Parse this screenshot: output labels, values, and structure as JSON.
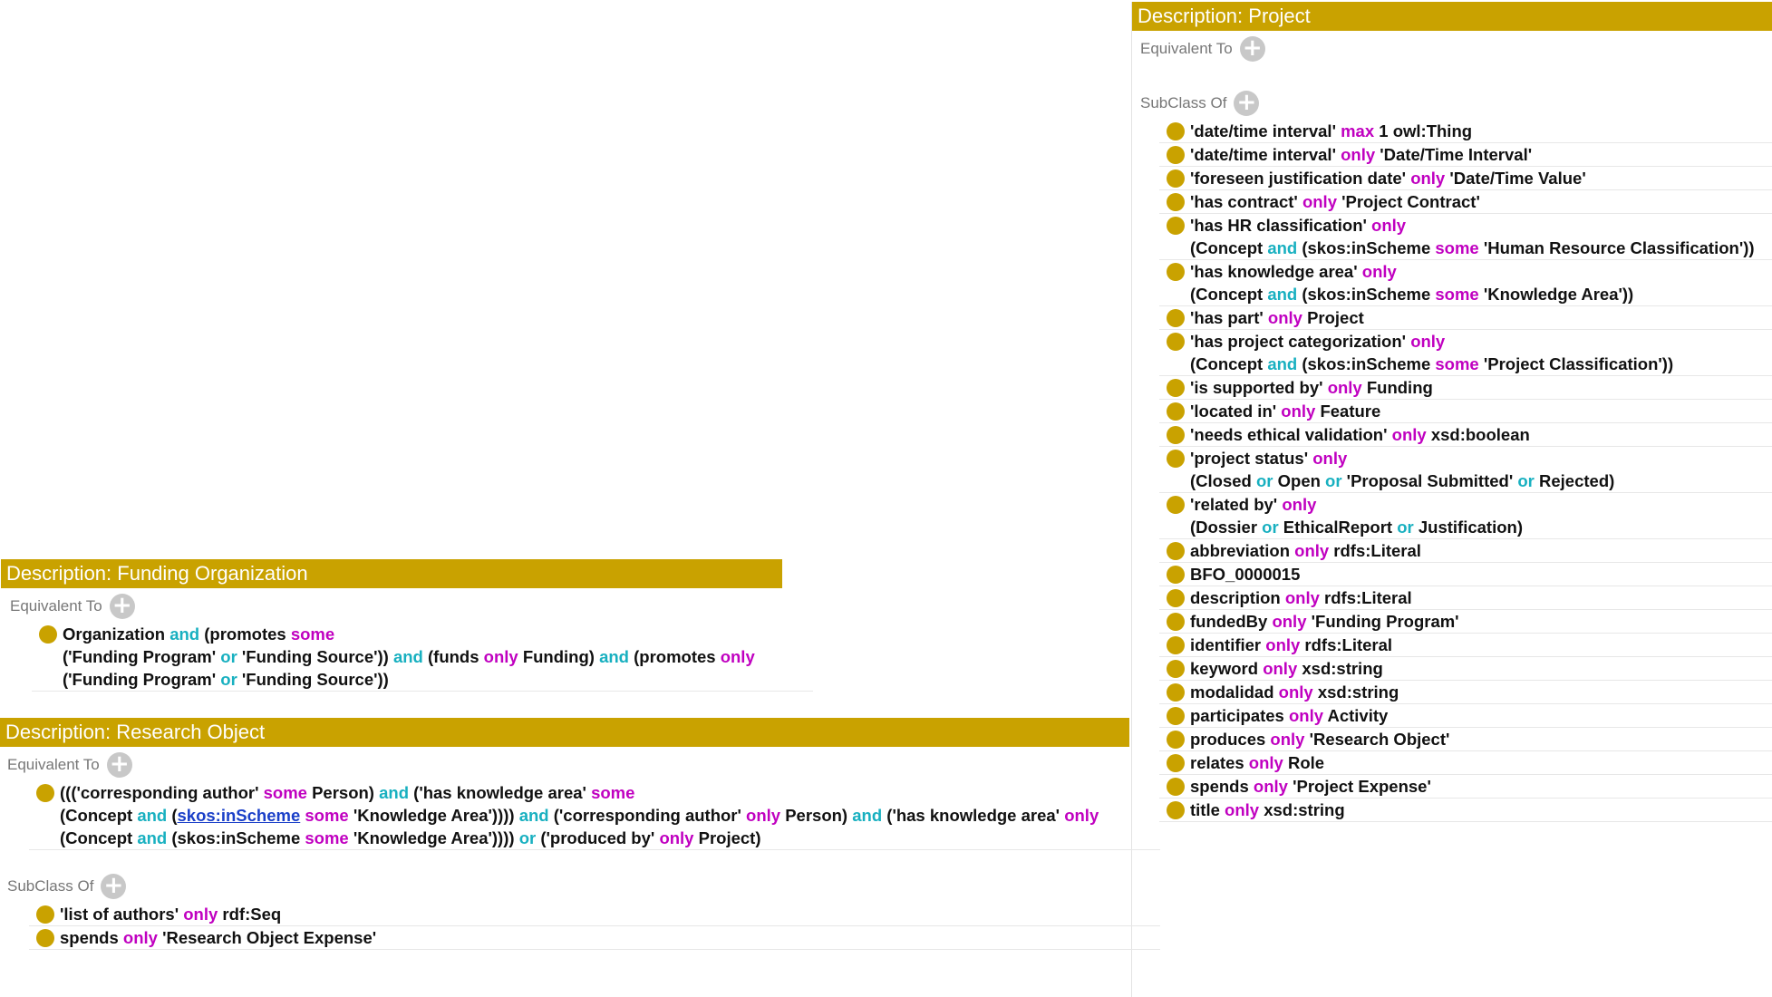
{
  "theme": {
    "header_bg": "#c9a200",
    "bullet": "#c9a200",
    "keyword_magenta": "#c000c0",
    "keyword_cyan": "#18b0c0",
    "link": "#1a3fc8"
  },
  "project": {
    "header": "Description: Project",
    "equivalent_label": "Equivalent To",
    "subclass_label": "SubClass Of",
    "add_icon": "plus-circle-icon",
    "axioms": [
      [
        [
          "'date/time interval' ",
          ""
        ],
        [
          "max",
          "p"
        ],
        [
          " 1 owl:Thing",
          ""
        ]
      ],
      [
        [
          "'date/time interval' ",
          ""
        ],
        [
          "only",
          "p"
        ],
        [
          " 'Date/Time Interval'",
          ""
        ]
      ],
      [
        [
          "'foreseen justification date' ",
          ""
        ],
        [
          "only",
          "p"
        ],
        [
          " 'Date/Time Value'",
          ""
        ]
      ],
      [
        [
          "'has contract' ",
          ""
        ],
        [
          "only",
          "p"
        ],
        [
          " 'Project Contract'",
          ""
        ]
      ],
      [
        [
          "'has HR classification' ",
          ""
        ],
        [
          "only",
          "p"
        ],
        [
          "\n(Concept ",
          ""
        ],
        [
          "and",
          "c"
        ],
        [
          " (skos:inScheme ",
          ""
        ],
        [
          "some",
          "p"
        ],
        [
          " 'Human Resource Classification'))",
          ""
        ]
      ],
      [
        [
          "'has knowledge area' ",
          ""
        ],
        [
          "only",
          "p"
        ],
        [
          "\n(Concept ",
          ""
        ],
        [
          "and",
          "c"
        ],
        [
          " (skos:inScheme ",
          ""
        ],
        [
          "some",
          "p"
        ],
        [
          " 'Knowledge Area'))",
          ""
        ]
      ],
      [
        [
          "'has part' ",
          ""
        ],
        [
          "only",
          "p"
        ],
        [
          " Project",
          ""
        ]
      ],
      [
        [
          "'has project categorization' ",
          ""
        ],
        [
          "only",
          "p"
        ],
        [
          "\n(Concept ",
          ""
        ],
        [
          "and",
          "c"
        ],
        [
          " (skos:inScheme ",
          ""
        ],
        [
          "some",
          "p"
        ],
        [
          " 'Project Classification'))",
          ""
        ]
      ],
      [
        [
          "'is supported by' ",
          ""
        ],
        [
          "only",
          "p"
        ],
        [
          " Funding",
          ""
        ]
      ],
      [
        [
          "'located in' ",
          ""
        ],
        [
          "only",
          "p"
        ],
        [
          " Feature",
          ""
        ]
      ],
      [
        [
          "'needs ethical validation' ",
          ""
        ],
        [
          "only",
          "p"
        ],
        [
          " xsd:boolean",
          ""
        ]
      ],
      [
        [
          "'project status' ",
          ""
        ],
        [
          "only",
          "p"
        ],
        [
          "\n(Closed ",
          ""
        ],
        [
          "or",
          "c"
        ],
        [
          " Open ",
          ""
        ],
        [
          "or",
          "c"
        ],
        [
          " 'Proposal Submitted' ",
          ""
        ],
        [
          "or",
          "c"
        ],
        [
          " Rejected)",
          ""
        ]
      ],
      [
        [
          "'related by' ",
          ""
        ],
        [
          "only",
          "p"
        ],
        [
          "\n(Dossier ",
          ""
        ],
        [
          "or",
          "c"
        ],
        [
          " EthicalReport ",
          ""
        ],
        [
          "or",
          "c"
        ],
        [
          " Justification)",
          ""
        ]
      ],
      [
        [
          "abbreviation ",
          ""
        ],
        [
          "only",
          "p"
        ],
        [
          " rdfs:Literal",
          ""
        ]
      ],
      [
        [
          "BFO_0000015",
          ""
        ]
      ],
      [
        [
          "description ",
          ""
        ],
        [
          "only",
          "p"
        ],
        [
          " rdfs:Literal",
          ""
        ]
      ],
      [
        [
          "fundedBy ",
          ""
        ],
        [
          "only",
          "p"
        ],
        [
          " 'Funding Program'",
          ""
        ]
      ],
      [
        [
          "identifier ",
          ""
        ],
        [
          "only",
          "p"
        ],
        [
          " rdfs:Literal",
          ""
        ]
      ],
      [
        [
          "keyword ",
          ""
        ],
        [
          "only",
          "p"
        ],
        [
          " xsd:string",
          ""
        ]
      ],
      [
        [
          "modalidad ",
          ""
        ],
        [
          "only",
          "p"
        ],
        [
          " xsd:string",
          ""
        ]
      ],
      [
        [
          "participates ",
          ""
        ],
        [
          "only",
          "p"
        ],
        [
          " Activity",
          ""
        ]
      ],
      [
        [
          "produces ",
          ""
        ],
        [
          "only",
          "p"
        ],
        [
          " 'Research Object'",
          ""
        ]
      ],
      [
        [
          "relates ",
          ""
        ],
        [
          "only",
          "p"
        ],
        [
          " Role",
          ""
        ]
      ],
      [
        [
          "spends ",
          ""
        ],
        [
          "only",
          "p"
        ],
        [
          " 'Project Expense'",
          ""
        ]
      ],
      [
        [
          "title ",
          ""
        ],
        [
          "only",
          "p"
        ],
        [
          " xsd:string",
          ""
        ]
      ]
    ]
  },
  "funding": {
    "header": "Description: Funding Organization",
    "equivalent_label": "Equivalent To",
    "add_icon": "plus-circle-icon",
    "equivalent": [
      [
        [
          "Organization ",
          ""
        ],
        [
          "and",
          "c"
        ],
        [
          " (promotes ",
          ""
        ],
        [
          "some",
          "p"
        ],
        [
          "\n('Funding Program' ",
          ""
        ],
        [
          "or",
          "c"
        ],
        [
          " 'Funding Source')) ",
          ""
        ],
        [
          "and",
          "c"
        ],
        [
          " (funds ",
          ""
        ],
        [
          "only",
          "p"
        ],
        [
          " Funding) ",
          ""
        ],
        [
          "and",
          "c"
        ],
        [
          " (promotes ",
          ""
        ],
        [
          "only",
          "p"
        ],
        [
          "\n('Funding Program' ",
          ""
        ],
        [
          "or",
          "c"
        ],
        [
          " 'Funding Source'))",
          ""
        ]
      ]
    ]
  },
  "research": {
    "header": "Description: Research Object",
    "equivalent_label": "Equivalent To",
    "subclass_label": "SubClass Of",
    "add_icon": "plus-circle-icon",
    "equivalent": [
      [
        [
          "((('corresponding author' ",
          ""
        ],
        [
          "some",
          "p"
        ],
        [
          " Person) ",
          ""
        ],
        [
          "and",
          "c"
        ],
        [
          " ('has knowledge area' ",
          ""
        ],
        [
          "some",
          "p"
        ],
        [
          "\n(Concept ",
          ""
        ],
        [
          "and",
          "c"
        ],
        [
          " (",
          ""
        ],
        [
          "skos:inScheme",
          "l"
        ],
        [
          " ",
          ""
        ],
        [
          "some",
          "p"
        ],
        [
          " 'Knowledge Area')))) ",
          ""
        ],
        [
          "and",
          "c"
        ],
        [
          " ('corresponding author' ",
          ""
        ],
        [
          "only",
          "p"
        ],
        [
          " Person) ",
          ""
        ],
        [
          "and",
          "c"
        ],
        [
          " ('has knowledge area' ",
          ""
        ],
        [
          "only",
          "p"
        ],
        [
          "\n(Concept ",
          ""
        ],
        [
          "and",
          "c"
        ],
        [
          " (skos:inScheme ",
          ""
        ],
        [
          "some",
          "p"
        ],
        [
          " 'Knowledge Area')))) ",
          ""
        ],
        [
          "or",
          "c"
        ],
        [
          " ('produced by' ",
          ""
        ],
        [
          "only",
          "p"
        ],
        [
          " Project)",
          ""
        ]
      ]
    ],
    "subclass": [
      [
        [
          "'list of authors' ",
          ""
        ],
        [
          "only",
          "p"
        ],
        [
          " rdf:Seq",
          ""
        ]
      ],
      [
        [
          "spends ",
          ""
        ],
        [
          "only",
          "p"
        ],
        [
          " 'Research Object Expense'",
          ""
        ]
      ]
    ]
  }
}
